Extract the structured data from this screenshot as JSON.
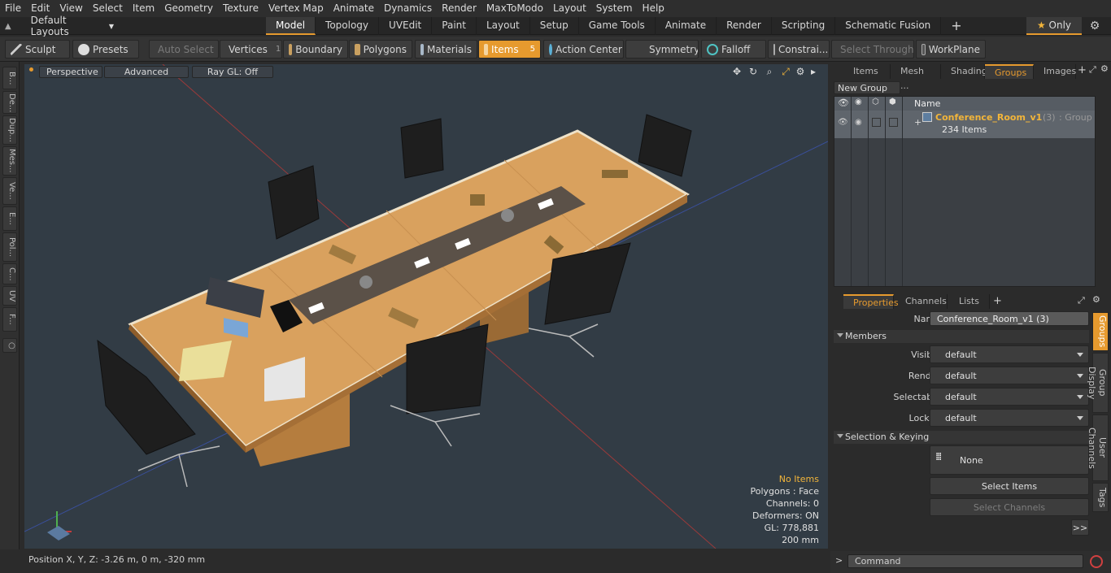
{
  "menu": [
    "File",
    "Edit",
    "View",
    "Select",
    "Item",
    "Geometry",
    "Texture",
    "Vertex Map",
    "Animate",
    "Dynamics",
    "Render",
    "MaxToModo",
    "Layout",
    "System",
    "Help"
  ],
  "layouts_label": "Default Layouts",
  "tabs": [
    {
      "label": "Model",
      "active": true
    },
    {
      "label": "Topology"
    },
    {
      "label": "UVEdit"
    },
    {
      "label": "Paint"
    },
    {
      "label": "Layout"
    },
    {
      "label": "Setup"
    },
    {
      "label": "Game Tools"
    },
    {
      "label": "Animate"
    },
    {
      "label": "Render"
    },
    {
      "label": "Scripting"
    },
    {
      "label": "Schematic Fusion"
    }
  ],
  "add_tab": "+",
  "only_label": "Only",
  "toolbar": {
    "sculpt": "Sculpt",
    "presets": "Presets",
    "auto_select": "Auto Select",
    "vertices": "Vertices",
    "vertices_count": "1",
    "boundary": "Boundary",
    "polygons": "Polygons",
    "materials": "Materials",
    "items": "Items",
    "items_count": "5",
    "action_center": "Action Center",
    "symmetry": "Symmetry",
    "falloff": "Falloff",
    "constraints": "Constrai...",
    "select_through": "Select Through",
    "workplane": "WorkPlane"
  },
  "left_tabs": [
    "B...",
    "De...",
    "Dup...",
    "Mes...",
    "Ve...",
    "E...",
    "Pol...",
    "C...",
    "UV",
    "F..."
  ],
  "viewport": {
    "perspective": "Perspective",
    "advanced": "Advanced",
    "raygl": "Ray GL: Off",
    "hud": {
      "no_items": "No Items",
      "polygons": "Polygons : Face",
      "channels": "Channels: 0",
      "deformers": "Deformers: ON",
      "gl": "GL: 778,881",
      "scale": "200 mm"
    }
  },
  "status": "Position X, Y, Z:   -3.26 m, 0 m, -320 mm",
  "right_panel": {
    "tabs": [
      "Items",
      "Mesh ...",
      "Shading",
      "Groups",
      "Images"
    ],
    "active_tab": "Groups",
    "new_group": "New Group",
    "col_name": "Name",
    "group_name": "Conference_Room_v1",
    "group_count": "(3)",
    "group_type": ": Group",
    "group_items": "234 Items"
  },
  "properties": {
    "tabs": [
      "Properties",
      "Channels",
      "Lists"
    ],
    "name_label": "Name",
    "name_value": "Conference_Room_v1 (3)",
    "members_label": "Members",
    "visible_label": "Visible",
    "render_label": "Render",
    "selectable_label": "Selectable",
    "locked_label": "Locked",
    "default": "default",
    "sel_keying_label": "Selection & Keying",
    "none_label": "None",
    "select_items": "Select Items",
    "select_channels": "Select Channels",
    "more": ">>",
    "vtabs": [
      "Groups",
      "Group Display",
      "User Channels",
      "Tags"
    ]
  },
  "command_placeholder": "Command",
  "colors": {
    "accent": "#e69a2e",
    "viewport": "#323c45",
    "wood": "#d9a15e"
  }
}
